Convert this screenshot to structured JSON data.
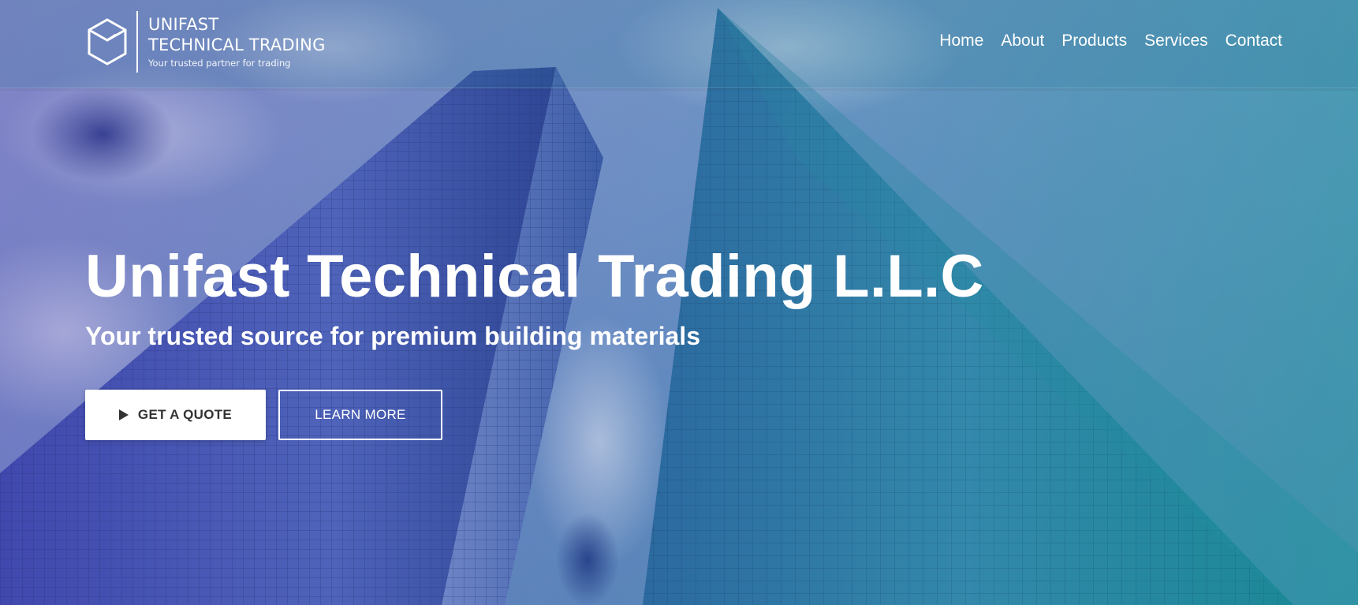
{
  "brand": {
    "name_line1": "UNIFAST",
    "name_line2": "TECHNICAL TRADING",
    "tagline": "Your trusted partner for trading",
    "icon": "hexagon-cube-icon"
  },
  "nav": {
    "items": [
      {
        "label": "Home"
      },
      {
        "label": "About"
      },
      {
        "label": "Products"
      },
      {
        "label": "Services"
      },
      {
        "label": "Contact"
      }
    ]
  },
  "hero": {
    "title": "Unifast Technical Trading L.L.C",
    "subtitle": "Your trusted source for premium building materials",
    "primary_button": {
      "label": "GET A QUOTE",
      "icon": "play-icon"
    },
    "secondary_button": {
      "label": "LEARN MORE"
    }
  },
  "colors": {
    "overlay_left": "#4a3eaa",
    "overlay_right": "#129696",
    "text": "#ffffff",
    "primary_button_bg": "#ffffff",
    "primary_button_text": "#333333"
  }
}
